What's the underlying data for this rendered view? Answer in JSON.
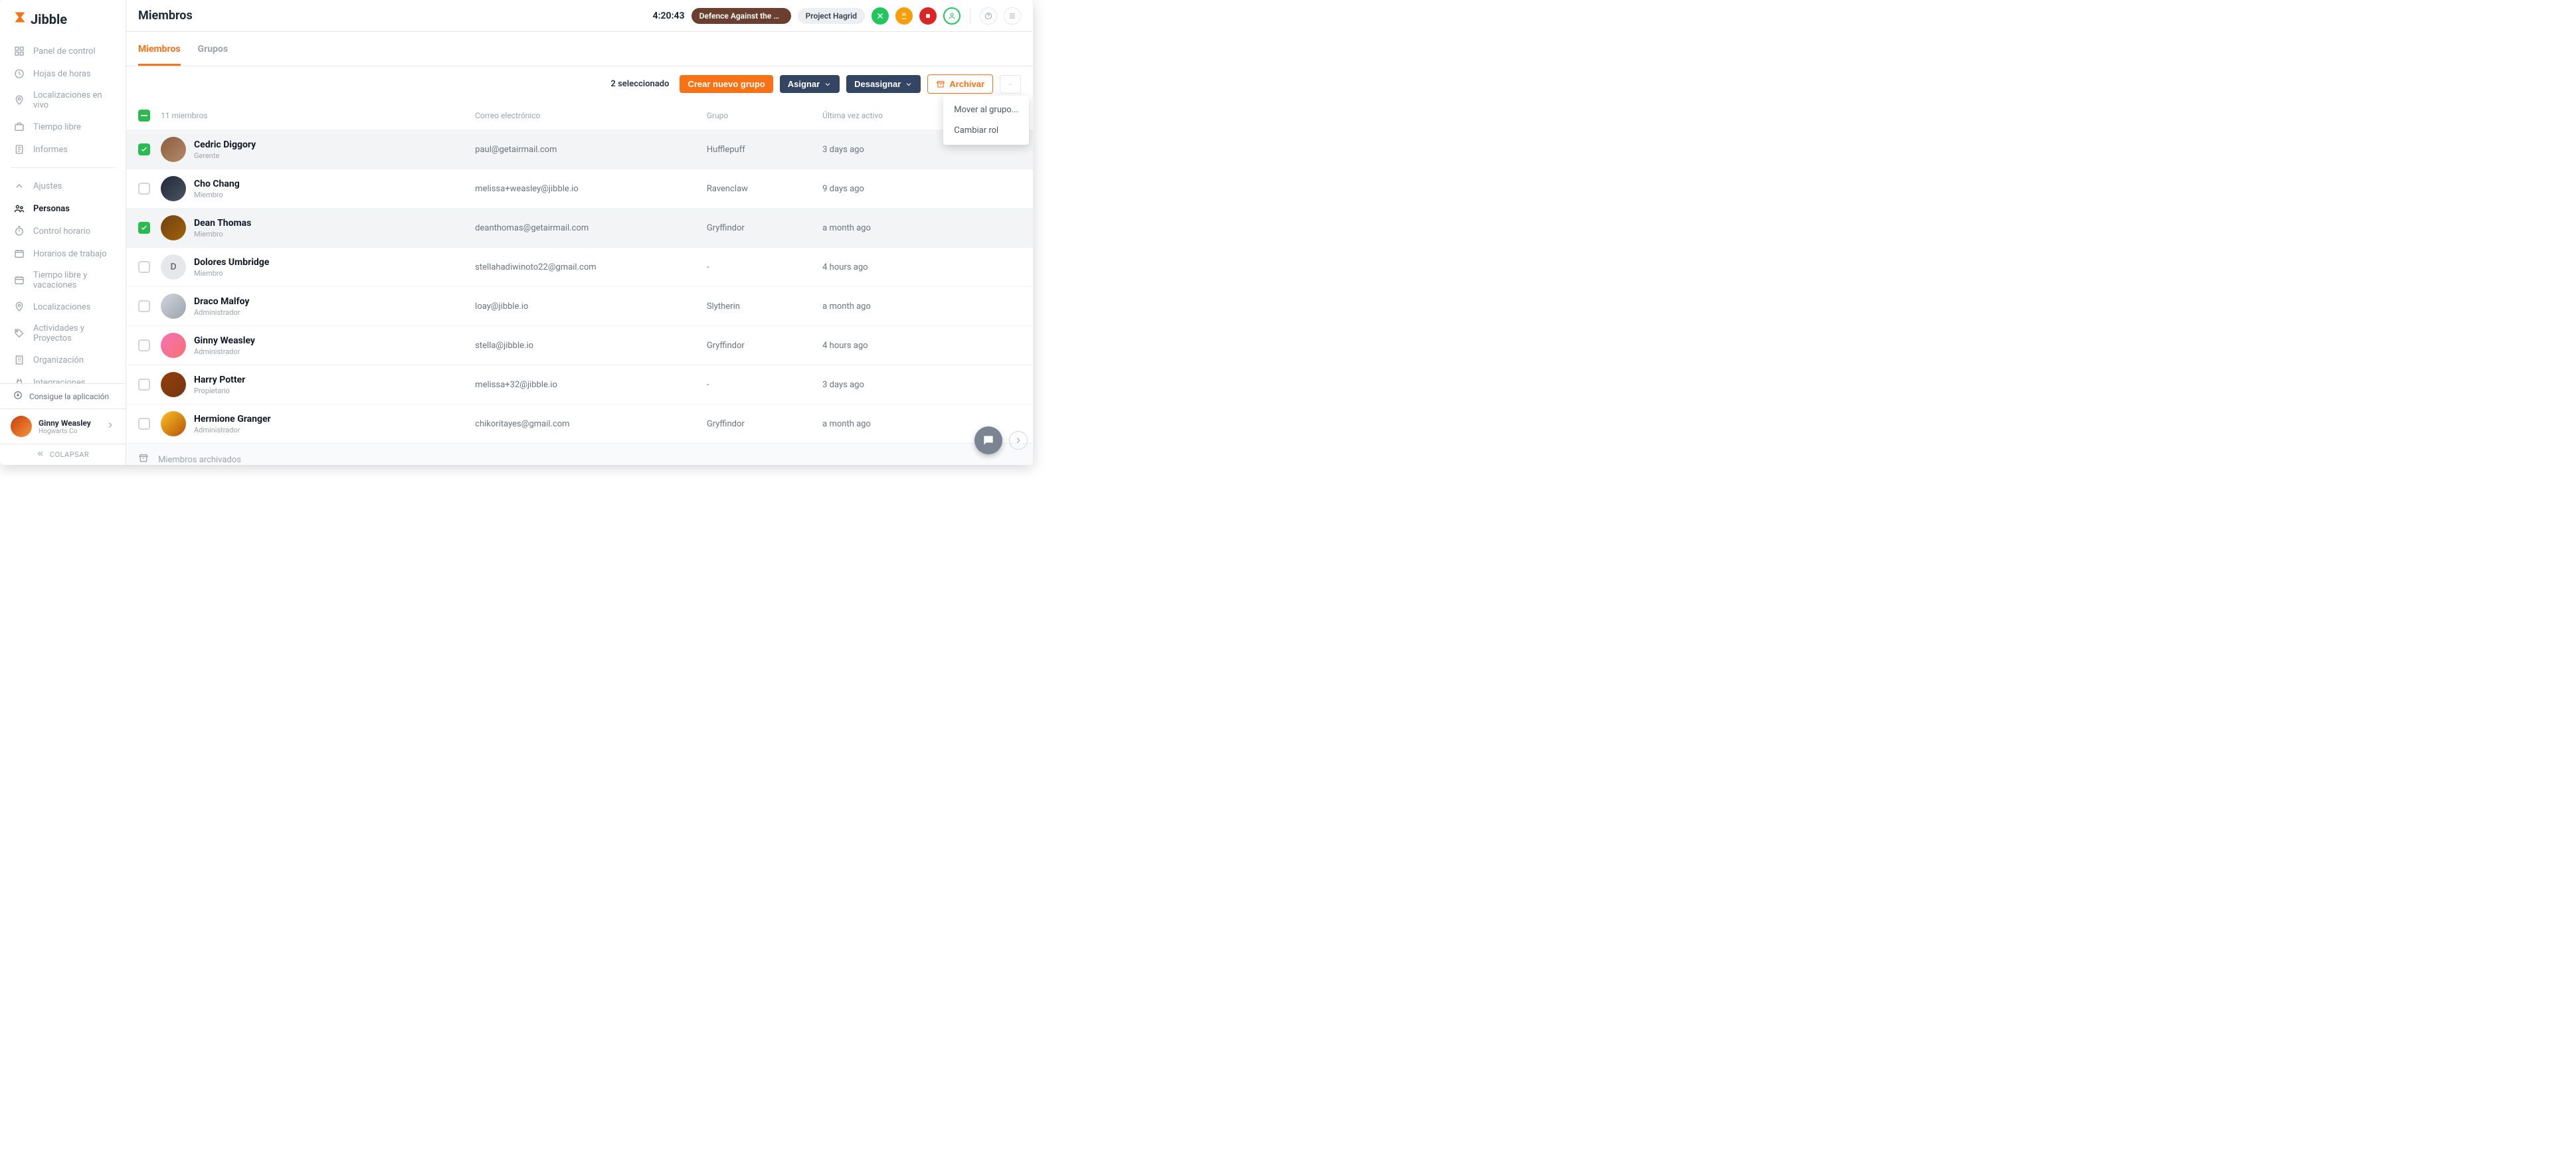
{
  "brand": "Jibble",
  "page_title": "Miembros",
  "timer": "4:20:43",
  "top_pill_dark": "Defence Against the D...",
  "top_pill_light": "Project Hagrid",
  "sidebar": {
    "items": [
      {
        "label": "Panel de control",
        "icon": "grid"
      },
      {
        "label": "Hojas de horas",
        "icon": "clock"
      },
      {
        "label": "Localizaciones en vivo",
        "icon": "pin"
      },
      {
        "label": "Tiempo libre",
        "icon": "briefcase"
      },
      {
        "label": "Informes",
        "icon": "report"
      }
    ],
    "settings": [
      {
        "label": "Ajustes",
        "icon": "chev"
      },
      {
        "label": "Personas",
        "icon": "people",
        "active": true
      },
      {
        "label": "Control horario",
        "icon": "timer"
      },
      {
        "label": "Horarios de trabajo",
        "icon": "schedule"
      },
      {
        "label": "Tiempo libre y vacaciones",
        "icon": "calendar"
      },
      {
        "label": "Localizaciones",
        "icon": "pin"
      },
      {
        "label": "Actividades y Proyectos",
        "icon": "tag"
      },
      {
        "label": "Organización",
        "icon": "building"
      },
      {
        "label": "Integraciones",
        "icon": "plug"
      }
    ],
    "get_app": "Consigue la aplicación",
    "user_name": "Ginny Weasley",
    "user_org": "Hogwarts Co",
    "collapse": "COLAPSAR"
  },
  "tabs": {
    "members": "Miembros",
    "groups": "Grupos"
  },
  "actions": {
    "selected": "2 seleccionado",
    "create_group": "Crear nuevo grupo",
    "assign": "Asignar",
    "unassign": "Desasignar",
    "archive": "Archivar",
    "menu": {
      "move": "Mover al grupo...",
      "change_role": "Cambiar rol"
    }
  },
  "columns": {
    "count": "11 miembros",
    "email": "Correo electrónico",
    "group": "Grupo",
    "last_active": "Última vez activo"
  },
  "members": [
    {
      "name": "Cedric Diggory",
      "role": "Gerente",
      "email": "paul@getairmail.com",
      "group": "Hufflepuff",
      "last": "3 days ago",
      "selected": true,
      "avatar": "av1"
    },
    {
      "name": "Cho Chang",
      "role": "Miembro",
      "email": "melissa+weasley@jibble.io",
      "group": "Ravenclaw",
      "last": "9 days ago",
      "selected": false,
      "avatar": "av2"
    },
    {
      "name": "Dean Thomas",
      "role": "Miembro",
      "email": "deanthomas@getairmail.com",
      "group": "Gryffindor",
      "last": "a month ago",
      "selected": true,
      "avatar": "av3"
    },
    {
      "name": "Dolores Umbridge",
      "role": "Miembro",
      "email": "stellahadiwinoto22@gmail.com",
      "group": "-",
      "last": "4 hours ago",
      "selected": false,
      "avatar": "initial",
      "initial": "D"
    },
    {
      "name": "Draco Malfoy",
      "role": "Administrador",
      "email": "loay@jibble.io",
      "group": "Slytherin",
      "last": "a month ago",
      "selected": false,
      "avatar": "av5"
    },
    {
      "name": "Ginny Weasley",
      "role": "Administrador",
      "email": "stella@jibble.io",
      "group": "Gryffindor",
      "last": "4 hours ago",
      "selected": false,
      "avatar": "av6"
    },
    {
      "name": "Harry Potter",
      "role": "Propietario",
      "email": "melissa+32@jibble.io",
      "group": "-",
      "last": "3 days ago",
      "selected": false,
      "avatar": "av7"
    },
    {
      "name": "Hermione Granger",
      "role": "Administrador",
      "email": "chikoritayes@gmail.com",
      "group": "Gryffindor",
      "last": "a month ago",
      "selected": false,
      "avatar": "av8"
    }
  ],
  "archived_label": "Miembros archivados"
}
